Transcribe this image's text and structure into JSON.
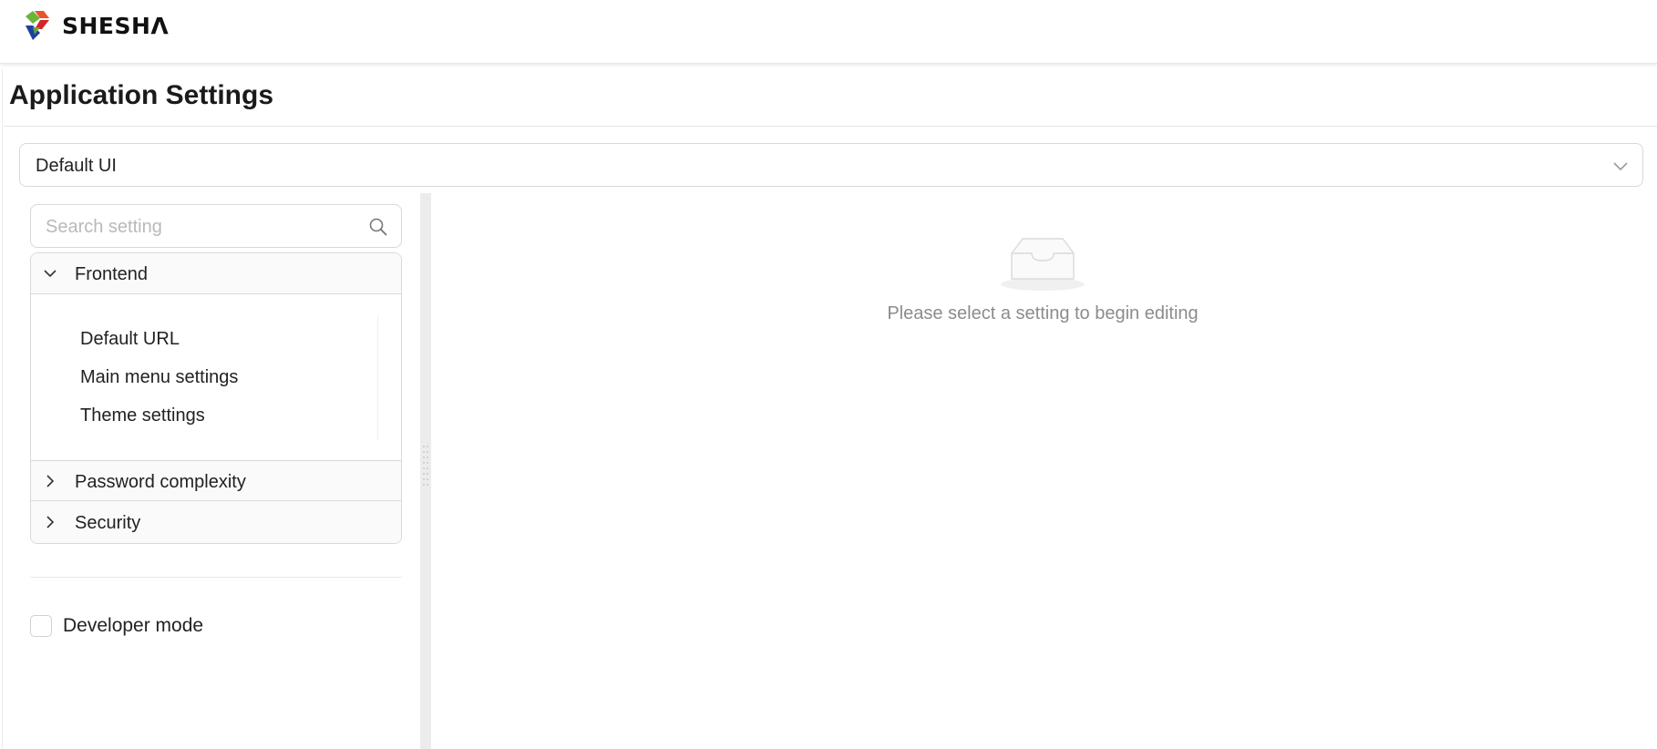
{
  "brand": {
    "name": "SHESHΛ",
    "colors": {
      "orange": "#e8542b",
      "green": "#6bb43a",
      "blue": "#1f3fa0",
      "red": "#d3262a"
    }
  },
  "page": {
    "title": "Application Settings"
  },
  "app_selector": {
    "value": "Default UI",
    "icon": "chevron-down-icon"
  },
  "search": {
    "placeholder": "Search setting",
    "value": "",
    "icon": "search-icon"
  },
  "groups": [
    {
      "label": "Frontend",
      "expanded": true,
      "icon": "chevron-down-icon",
      "items": [
        {
          "label": "Default URL"
        },
        {
          "label": "Main menu settings"
        },
        {
          "label": "Theme settings"
        }
      ]
    },
    {
      "label": "Password complexity",
      "expanded": false,
      "icon": "chevron-right-icon"
    },
    {
      "label": "Security",
      "expanded": false,
      "icon": "chevron-right-icon"
    }
  ],
  "developer_mode": {
    "label": "Developer mode",
    "checked": false
  },
  "empty_state": {
    "message": "Please select a setting to begin editing",
    "icon": "empty-inbox-icon"
  }
}
